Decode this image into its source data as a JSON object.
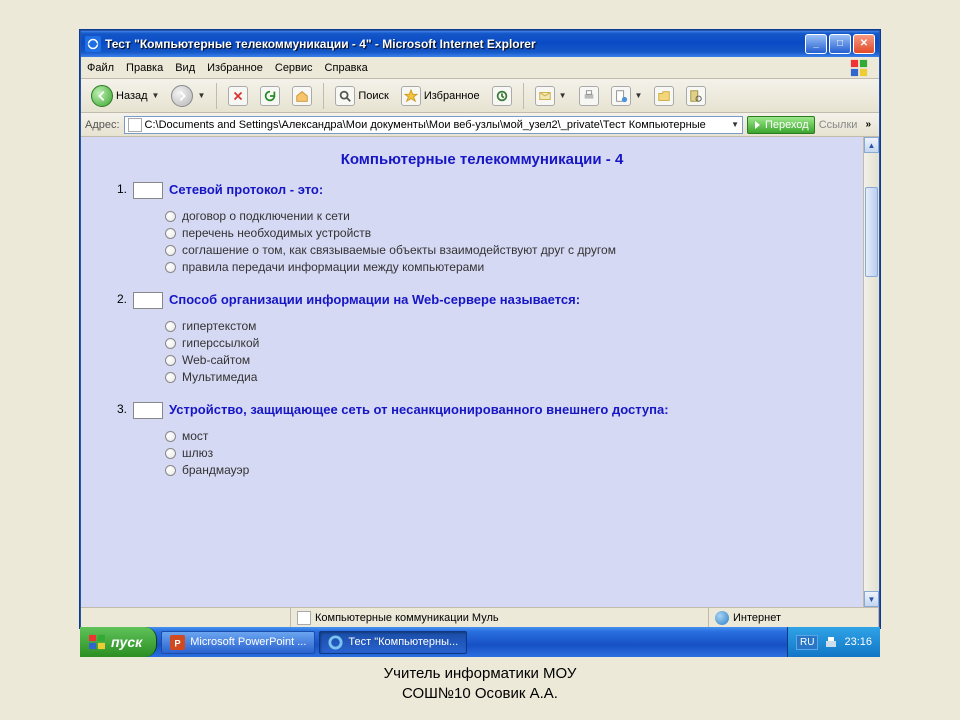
{
  "window": {
    "title": "Тест \"Компьютерные телекоммуникации - 4\" - Microsoft Internet Explorer"
  },
  "menu": {
    "items": [
      "Файл",
      "Правка",
      "Вид",
      "Избранное",
      "Сервис",
      "Справка"
    ]
  },
  "toolbar": {
    "back": "Назад",
    "search": "Поиск",
    "favorites": "Избранное"
  },
  "address": {
    "label": "Адрес:",
    "value": "C:\\Documents and Settings\\Александра\\Мои документы\\Мои веб-узлы\\мой_узел2\\_private\\Тест Компьютерные",
    "go": "Переход",
    "links": "Ссылки"
  },
  "page": {
    "title": "Компьютерные телекоммуникации - 4",
    "questions": [
      {
        "num": "1.",
        "text": "Сетевой протокол - это:",
        "options": [
          "договор о подключении к сети",
          "перечень необходимых устройств",
          "соглашение о том, как связываемые объекты взаимодействуют друг с другом",
          "правила передачи информации между компьютерами"
        ]
      },
      {
        "num": "2.",
        "text": "Способ организации информации на  Web-сервере называется:",
        "options": [
          "гипертекстом",
          "гиперссылкой",
          "Web-сайтом",
          "Мультимедиа"
        ]
      },
      {
        "num": "3.",
        "text": "Устройство, защищающее сеть от несанкционированного внешнего доступа:",
        "options": [
          "мост",
          "шлюз",
          "брандмауэр"
        ]
      }
    ]
  },
  "iestatus": {
    "doc": "Компьютерные коммуникации Муль",
    "zone": "Интернет"
  },
  "taskbar": {
    "start": "пуск",
    "items": [
      "Microsoft PowerPoint ...",
      "Тест \"Компьютерны..."
    ],
    "lang": "RU",
    "time": "23:16"
  },
  "caption": {
    "line1": "Учитель информатики МОУ",
    "line2": "СОШ№10 Осовик А.А."
  }
}
